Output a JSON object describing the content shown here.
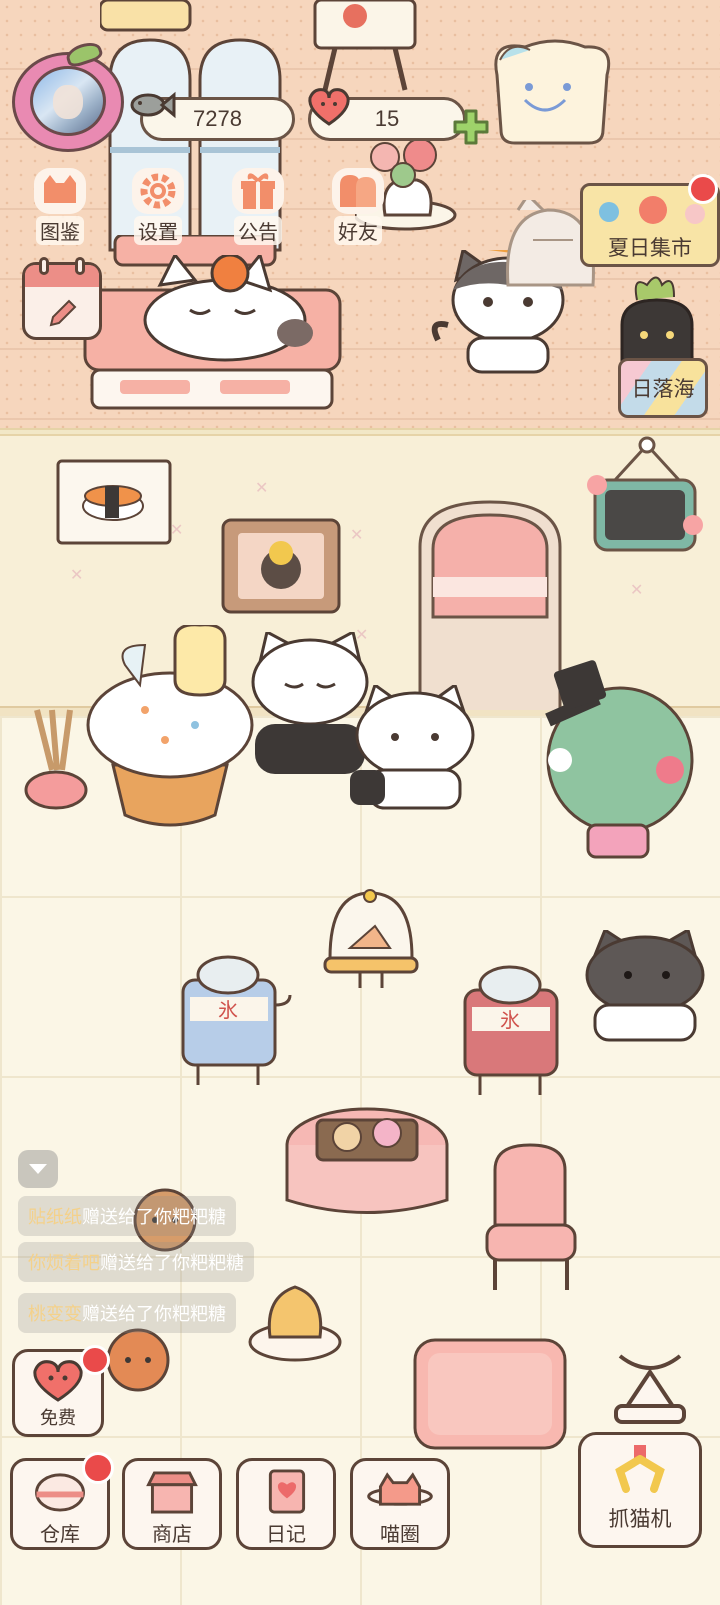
{
  "hud": {
    "fish_count": "7278",
    "heart_count": "15",
    "menu": [
      {
        "label": "图鉴",
        "icon": "cat-book-icon"
      },
      {
        "label": "设置",
        "icon": "gear-icon"
      },
      {
        "label": "公告",
        "icon": "gift-icon"
      },
      {
        "label": "好友",
        "icon": "friends-icon"
      }
    ]
  },
  "signs": {
    "market": "夏日集市",
    "sunset": "日落海"
  },
  "chat": [
    {
      "who": "贴纸纸",
      "msg": "赠送给了你粑粑糖"
    },
    {
      "who": "你烦着吧",
      "msg": "赠送给了你粑粑糖"
    },
    {
      "who": "桃变变",
      "msg": "赠送给了你粑粑糖"
    }
  ],
  "free_button": {
    "label": "免费"
  },
  "bottom_bar": [
    {
      "label": "仓库",
      "icon": "bowl-icon"
    },
    {
      "label": "商店",
      "icon": "shop-icon"
    },
    {
      "label": "日记",
      "icon": "diary-icon"
    },
    {
      "label": "喵圈",
      "icon": "cat-planet-icon"
    }
  ],
  "claw_machine": {
    "label": "抓猫机"
  },
  "colors": {
    "accent": "#ec8e87",
    "badge": "#ea4a4a",
    "outline": "#5c4438",
    "wall": "#f6d6bd",
    "floor": "#fbf6e6"
  }
}
